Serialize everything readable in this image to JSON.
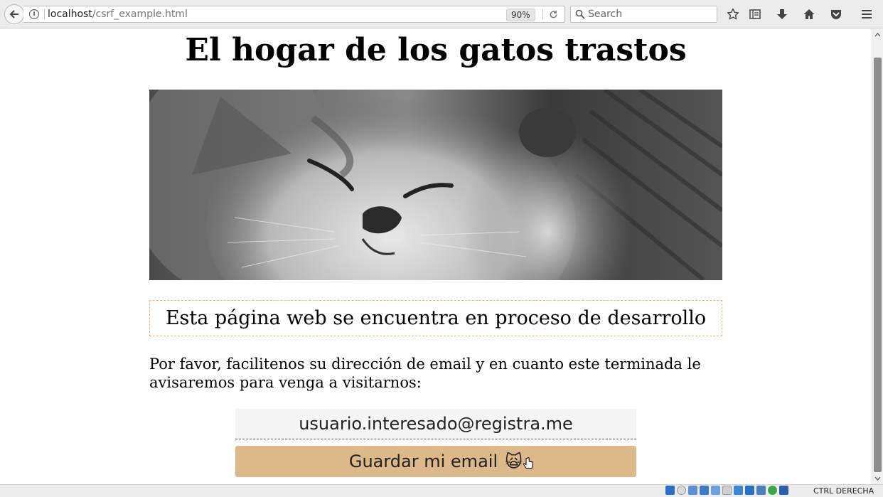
{
  "browser": {
    "url_host": "localhost",
    "url_path": "/csrf_example.html",
    "zoom": "90%",
    "search_placeholder": "Search"
  },
  "page": {
    "title": "El hogar de los gatos trastos",
    "hero_image": "kitten-sleeping-grayscale",
    "notice": "Esta página web se encuentra en proceso de desarrollo",
    "intro": "Por favor, facilitenos su dirección de email y en cuanto este terminada le avisaremos para venga a visitarnos:",
    "email_value": "usuario.interesado@registra.me",
    "submit_label": "Guardar mi email",
    "submit_emoji": "🙀"
  },
  "statusbar": {
    "host_key": "CTRL DERECHA"
  },
  "colors": {
    "notice_border": "#e0b788",
    "button_bg": "#ddb888"
  }
}
